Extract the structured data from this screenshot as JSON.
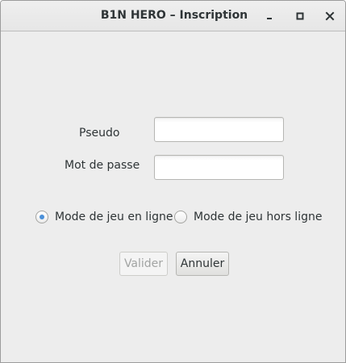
{
  "window": {
    "title": "B1N HERO – Inscription",
    "controls": [
      "minimize-icon",
      "maximize-icon",
      "close-icon"
    ]
  },
  "form": {
    "pseudo_label": "Pseudo",
    "pseudo_value": "",
    "password_label": "Mot de passe",
    "password_value": ""
  },
  "mode": {
    "online_label": "Mode de jeu en ligne",
    "offline_label": "Mode de jeu hors ligne",
    "selected": "online"
  },
  "buttons": {
    "validate_label": "Valider",
    "validate_enabled": false,
    "cancel_label": "Annuler"
  },
  "colors": {
    "accent": "#4a90d9",
    "window_bg": "#ededed",
    "text": "#2e3436",
    "disabled_text": "#a2a4a3"
  }
}
